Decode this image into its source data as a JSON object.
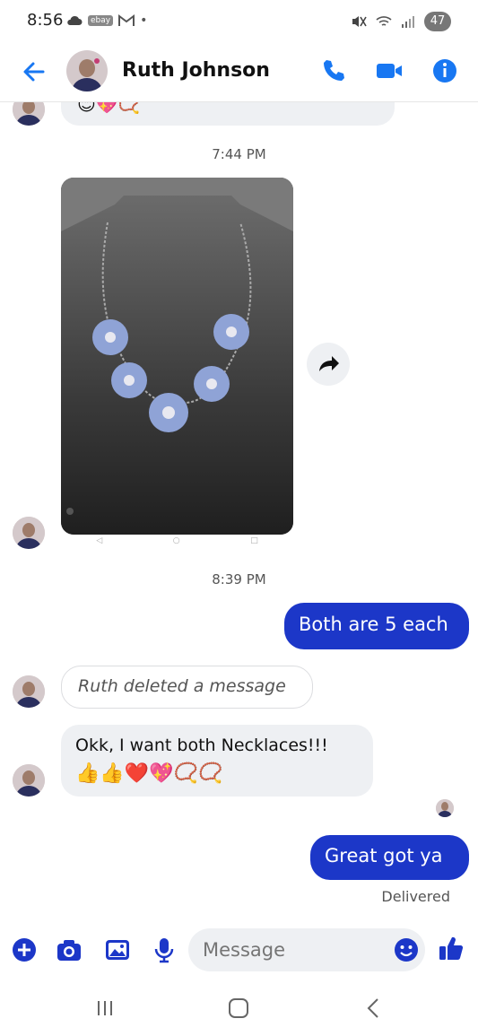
{
  "status_bar": {
    "time": "8:56",
    "ebay": "ebay",
    "battery": "47"
  },
  "header": {
    "contact_name": "Ruth Johnson",
    "back_icon": "arrow-left-icon",
    "call_icon": "phone-icon",
    "video_icon": "video-camera-icon",
    "info_icon": "info-icon"
  },
  "messages": {
    "top_partial_emojis": "😊💖📿",
    "timestamp_1": "7:44 PM",
    "timestamp_2": "8:39 PM",
    "outgoing_1": "Both are 5 each",
    "deleted_notice": "Ruth deleted a message",
    "incoming_1_text": "Okk, I want both Necklaces!!!",
    "incoming_1_emojis": "👍👍❤️💖📿📿",
    "outgoing_2": "Great got ya",
    "delivered": "Delivered"
  },
  "composer": {
    "placeholder": "Message"
  },
  "colors": {
    "accent": "#1877f2",
    "outgoing_bubble": "#1c37c8",
    "incoming_bubble": "#eef0f3"
  }
}
